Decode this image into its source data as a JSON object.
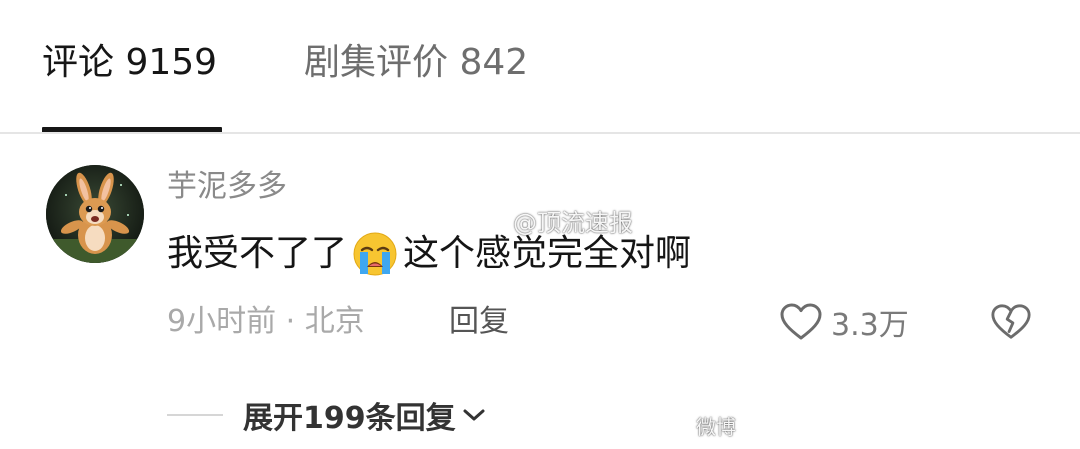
{
  "tabs": [
    {
      "label": "评论 9159",
      "active": true
    },
    {
      "label": "剧集评价 842",
      "active": false
    }
  ],
  "comment": {
    "username": "芋泥多多",
    "text_before_emoji": "我受不了了",
    "emoji": "loudly-crying-face",
    "text_after_emoji": "这个感觉完全对啊",
    "meta": "9小时前 · 北京",
    "reply_label": "回复",
    "like_count": "3.3万",
    "icons": {
      "like": "heart-outline-icon",
      "dislike": "broken-heart-icon",
      "avatar": "rabbit-avatar"
    }
  },
  "expand": {
    "label": "展开199条回复"
  },
  "watermark": {
    "top": "@顶流速报",
    "bottom": "微博"
  },
  "colors": {
    "primary_text": "#161616",
    "secondary_text": "#8a8a8a",
    "meta_text": "#a9a9a9",
    "divider": "#e5e5e5"
  }
}
